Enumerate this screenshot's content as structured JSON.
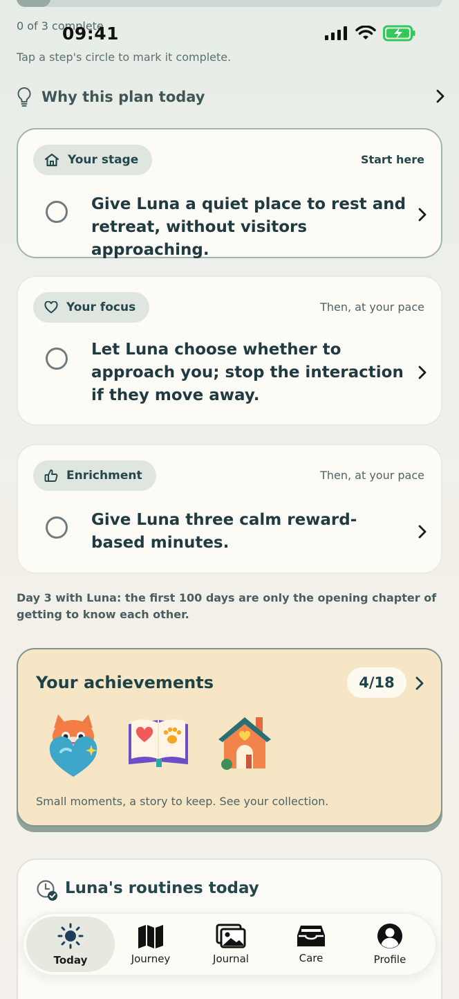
{
  "progress": {
    "completed": 0,
    "total": 3,
    "label": "0 of 3 complete",
    "fraction": 0.08
  },
  "status_bar": {
    "time": "09:41"
  },
  "hint": "Tap a step's circle to mark it complete.",
  "why_plan": {
    "label": "Why this plan today"
  },
  "steps": [
    {
      "tag": "Your stage",
      "tag_icon": "house-icon",
      "meta": "Start here",
      "text": "Give Luna a quiet place to rest and retreat, without visitors approaching."
    },
    {
      "tag": "Your focus",
      "tag_icon": "heart-icon",
      "meta": "Then, at your pace",
      "text": "Let Luna choose whether to approach you; stop the interaction if they move away."
    },
    {
      "tag": "Enrichment",
      "tag_icon": "thumbs-up-icon",
      "meta": "Then, at your pace",
      "text": "Give Luna three calm reward-based minutes."
    }
  ],
  "day_note": "Day 3 with Luna: the first 100 days are only the opening chapter of getting to know each other.",
  "achievements": {
    "title": "Your achievements",
    "count": "4/18",
    "badges": [
      "cat-heart-icon",
      "paw-book-icon",
      "home-icon"
    ],
    "footer": "Small moments, a story to keep. See your collection."
  },
  "routines": {
    "title": "Luna's routines today"
  },
  "tabs": [
    {
      "label": "Today",
      "icon": "sun-icon",
      "active": true
    },
    {
      "label": "Journey",
      "icon": "map-icon",
      "active": false
    },
    {
      "label": "Journal",
      "icon": "photos-icon",
      "active": false
    },
    {
      "label": "Care",
      "icon": "tray-icon",
      "active": false
    },
    {
      "label": "Profile",
      "icon": "person-icon",
      "active": false
    }
  ],
  "colors": {
    "accent": "#1f3a40",
    "achievement_bg": "#f7e6c6",
    "card_bg": "#fdfbf6"
  }
}
